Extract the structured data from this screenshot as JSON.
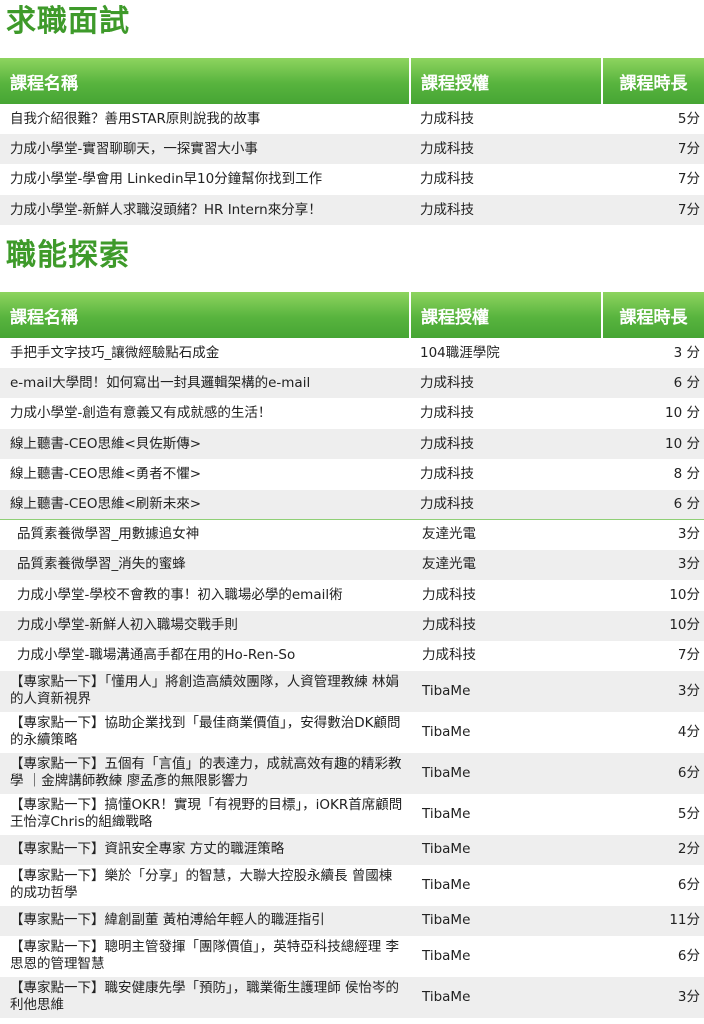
{
  "sections": [
    {
      "title": "求職面試",
      "headers": [
        "課程名稱",
        "課程授權",
        "課程時長"
      ],
      "rows": [
        {
          "name": "自我介紹很難？善用STAR原則說我的故事",
          "provider": "力成科技",
          "duration": "5分"
        },
        {
          "name": "力成小學堂-實習聊聊天，一探實習大小事",
          "provider": "力成科技",
          "duration": "7分"
        },
        {
          "name": "力成小學堂-學會用 Linkedin早10分鐘幫你找到工作",
          "provider": "力成科技",
          "duration": "7分"
        },
        {
          "name": "力成小學堂-新鮮人求職沒頭緒？HR Intern來分享！",
          "provider": "力成科技",
          "duration": "7分"
        }
      ]
    },
    {
      "title": "職能探索",
      "headers": [
        "課程名稱",
        "課程授權",
        "課程時長"
      ],
      "rows": [
        {
          "name": "手把手文字技巧_讓微經驗點石成金",
          "provider": "104職涯學院",
          "duration": "3 分"
        },
        {
          "name": "e-mail大學問！如何寫出一封具邏輯架構的e-mail",
          "provider": "力成科技",
          "duration": "6 分"
        },
        {
          "name": "力成小學堂-創造有意義又有成就感的生活！",
          "provider": "力成科技",
          "duration": "10 分"
        },
        {
          "name": "線上聽書-CEO思維<貝佐斯傳>",
          "provider": "力成科技",
          "duration": "10 分"
        },
        {
          "name": "線上聽書-CEO思維<勇者不懼>",
          "provider": "力成科技",
          "duration": "8 分"
        },
        {
          "name": "線上聽書-CEO思維<刷新未來>",
          "provider": "力成科技",
          "duration": "6 分"
        },
        {
          "name": "品質素養微學習_用數據追女神",
          "provider": "友達光電",
          "duration": "3分"
        },
        {
          "name": "品質素養微學習_消失的蜜蜂",
          "provider": "友達光電",
          "duration": "3分"
        },
        {
          "name": "力成小學堂-學校不會教的事！初入職場必學的email術",
          "provider": "力成科技",
          "duration": "10分"
        },
        {
          "name": "力成小學堂-新鮮人初入職場交戰手則",
          "provider": "力成科技",
          "duration": "10分"
        },
        {
          "name": "力成小學堂-職場溝通高手都在用的Ho-Ren-So",
          "provider": "力成科技",
          "duration": "7分"
        },
        {
          "name": "【專家點一下】「懂用人」將創造高績效團隊，人資管理教練 林娟的人資新視界",
          "provider": "TibaMe",
          "duration": "3分"
        },
        {
          "name": "【專家點一下】協助企業找到「最佳商業價值」，安得數治DK顧問的永續策略",
          "provider": "TibaMe",
          "duration": "4分"
        },
        {
          "name": "【專家點一下】五個有「言值」的表達力，成就高效有趣的精彩教學 ｜金牌講師教練 廖孟彥的無限影響力",
          "provider": "TibaMe",
          "duration": "6分"
        },
        {
          "name": "【專家點一下】搞懂OKR！實現「有視野的目標」，iOKR首席顧問 王怡淳Chris的組織戰略",
          "provider": "TibaMe",
          "duration": "5分"
        },
        {
          "name": "【專家點一下】資訊安全專家 方丈的職涯策略",
          "provider": "TibaMe",
          "duration": "2分"
        },
        {
          "name": "【專家點一下】樂於「分享」的智慧，大聯大控股永續長 曾國棟的成功哲學",
          "provider": "TibaMe",
          "duration": "6分"
        },
        {
          "name": "【專家點一下】緯創副董 黃柏溥給年輕人的職涯指引",
          "provider": "TibaMe",
          "duration": "11分"
        },
        {
          "name": "【專家點一下】聰明主管發揮「團隊價值」，英特亞科技總經理 李思恩的管理智慧",
          "provider": "TibaMe",
          "duration": "6分"
        },
        {
          "name": "【專家點一下】職安健康先學「預防」，職業衛生護理師 侯怡岑的利他思維",
          "provider": "TibaMe",
          "duration": "3分"
        }
      ]
    }
  ]
}
